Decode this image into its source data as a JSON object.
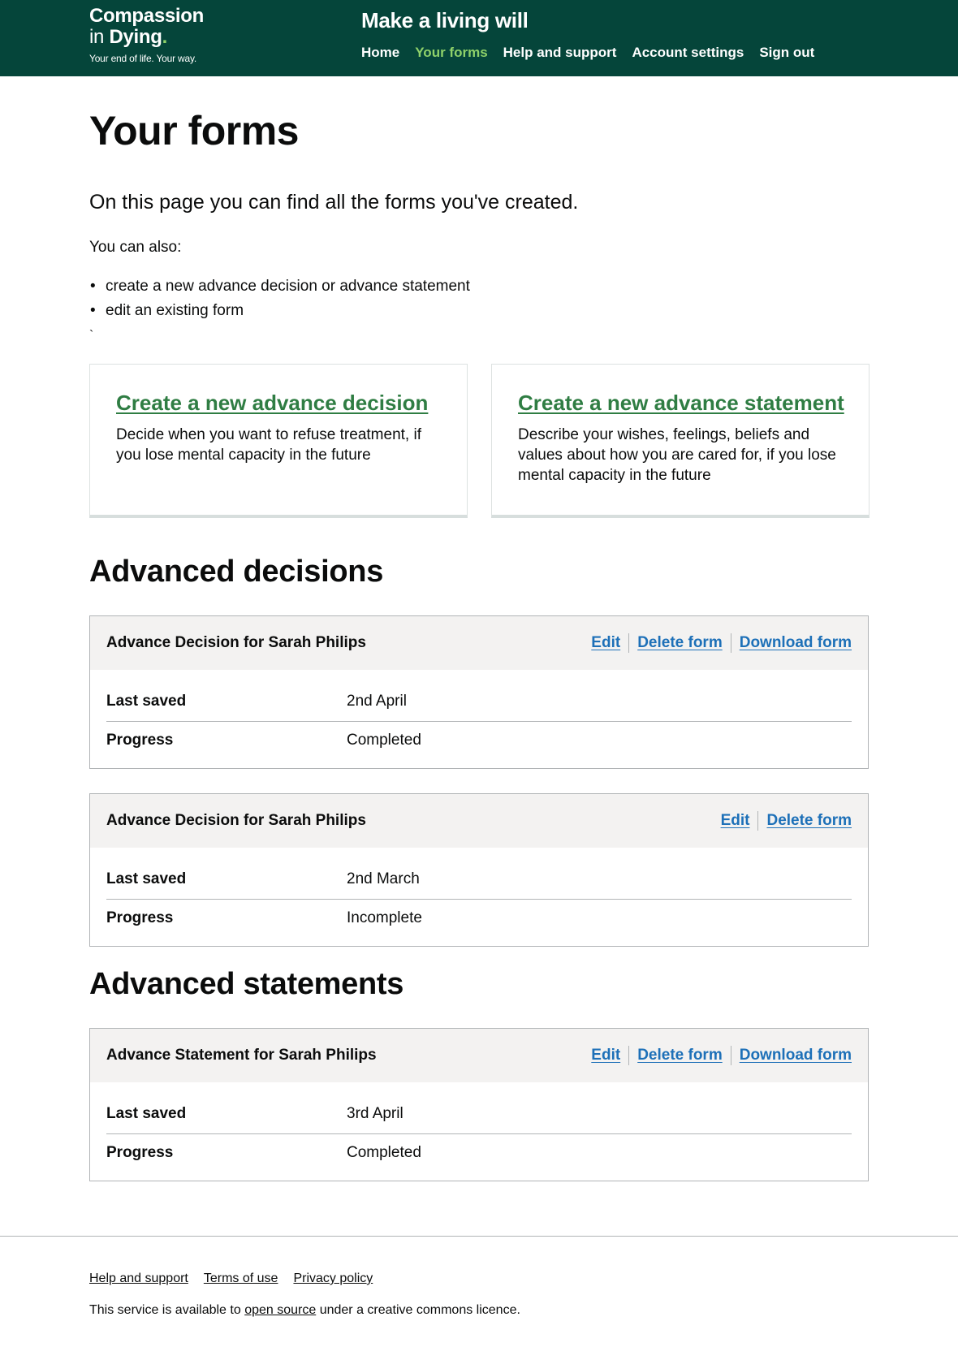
{
  "header": {
    "logo": {
      "line1": "Compassion",
      "line2_prefix": "in ",
      "line2_bold": "Dying",
      "dot": ".",
      "tagline": "Your end of life. Your way."
    },
    "service_name": "Make a living will",
    "nav": [
      {
        "label": "Home",
        "active": false
      },
      {
        "label": "Your forms",
        "active": true
      },
      {
        "label": "Help and support",
        "active": false
      },
      {
        "label": "Account settings",
        "active": false
      },
      {
        "label": "Sign out",
        "active": false
      }
    ],
    "colors": {
      "background": "#05453a",
      "active": "#8fd16a"
    }
  },
  "main": {
    "title": "Your forms",
    "lead": "On this page you can find all the forms you've created.",
    "intro": "You can also:",
    "bullets": [
      "create a new advance decision or advance statement",
      "edit an existing form"
    ],
    "stray_char": "`",
    "cards": [
      {
        "link": "Create a new advance decision",
        "description": "Decide when you want to refuse treatment, if you lose mental capacity in the future"
      },
      {
        "link": "Create a new advance statement",
        "description": "Describe your wishes, feelings, beliefs and values about how you are cared for, if you lose mental capacity in the future"
      }
    ],
    "sections": {
      "decisions": {
        "heading": "Advanced decisions",
        "forms": [
          {
            "title": "Advance Decision for Sarah Philips",
            "actions": [
              "Edit",
              "Delete form",
              "Download form"
            ],
            "rows": [
              {
                "key": "Last saved",
                "value": "2nd April"
              },
              {
                "key": "Progress",
                "value": "Completed"
              }
            ]
          },
          {
            "title": "Advance Decision for Sarah Philips",
            "actions": [
              "Edit",
              "Delete form"
            ],
            "rows": [
              {
                "key": "Last saved",
                "value": "2nd March"
              },
              {
                "key": "Progress",
                "value": "Incomplete"
              }
            ]
          }
        ]
      },
      "statements": {
        "heading": "Advanced statements",
        "forms": [
          {
            "title": "Advance Statement for Sarah Philips",
            "actions": [
              "Edit",
              "Delete form",
              "Download form"
            ],
            "rows": [
              {
                "key": "Last saved",
                "value": "3rd April"
              },
              {
                "key": "Progress",
                "value": "Completed"
              }
            ]
          }
        ]
      }
    },
    "colors": {
      "link": "#1d70b8",
      "card_link": "#2f7d43",
      "summary_head_bg": "#f3f2f1"
    }
  },
  "footer": {
    "links": [
      "Help and support",
      "Terms of use",
      "Privacy policy"
    ],
    "licence_prefix": "This service is available to ",
    "licence_link": "open source",
    "licence_suffix": " under a creative commons licence."
  }
}
